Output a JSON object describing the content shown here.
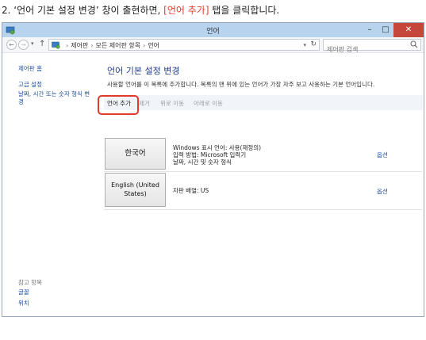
{
  "instruction": {
    "prefix": "2. ‘언어 기본 설정 변경’ 창이 출현하면, ",
    "highlight": "[언어 추가]",
    "suffix": " 탭을  클릭합니다."
  },
  "window": {
    "title": "언어",
    "buttons": {
      "minimize": "–",
      "maximize": "□",
      "close": "✕"
    }
  },
  "address": {
    "back": "←",
    "forward": "→",
    "up": "↑",
    "dropdown": "▾",
    "refresh": "↻",
    "breadcrumbs": [
      "제어판",
      "모든 제어판 항목",
      "언어"
    ],
    "separator": "›",
    "search_placeholder": "제어판 검색"
  },
  "sidebar": {
    "home": "제어판 홈",
    "advanced": "고급 설정",
    "datetime": "날짜, 시간 또는 숫자 형식 변경",
    "see_also": "참고 항목",
    "fonts": "글꼴",
    "location": "위치"
  },
  "main": {
    "title": "언어 기본 설정 변경",
    "description": "사용할 언어를 이 목록에 추가합니다. 목록의 맨 위에 있는 언어가 가장 자주 보고 사용하는 기본 언어입니다.",
    "tabs": {
      "add": "언어 추가",
      "remove": "제거",
      "move_up": "위로 이동",
      "move_down": "아래로 이동"
    },
    "languages": [
      {
        "name": "한국어",
        "info": [
          "Windows 표시 언어: 사용(재정의)",
          "입력 방법: Microsoft 입력기",
          "날짜, 시간 및 숫자 형식"
        ],
        "options": "옵션"
      },
      {
        "name": "English (United States)",
        "info": [
          "자판 배열: US"
        ],
        "options": "옵션"
      }
    ]
  },
  "colors": {
    "highlight_red": "#e1392c",
    "title_blue": "#1e3a8a",
    "link_blue": "#1e4fa3",
    "titlebar": "#b8d3ee"
  },
  "icons": [
    "control-panel-icon",
    "search-icon",
    "back-arrow-icon",
    "forward-arrow-icon",
    "up-arrow-icon",
    "refresh-icon"
  ]
}
